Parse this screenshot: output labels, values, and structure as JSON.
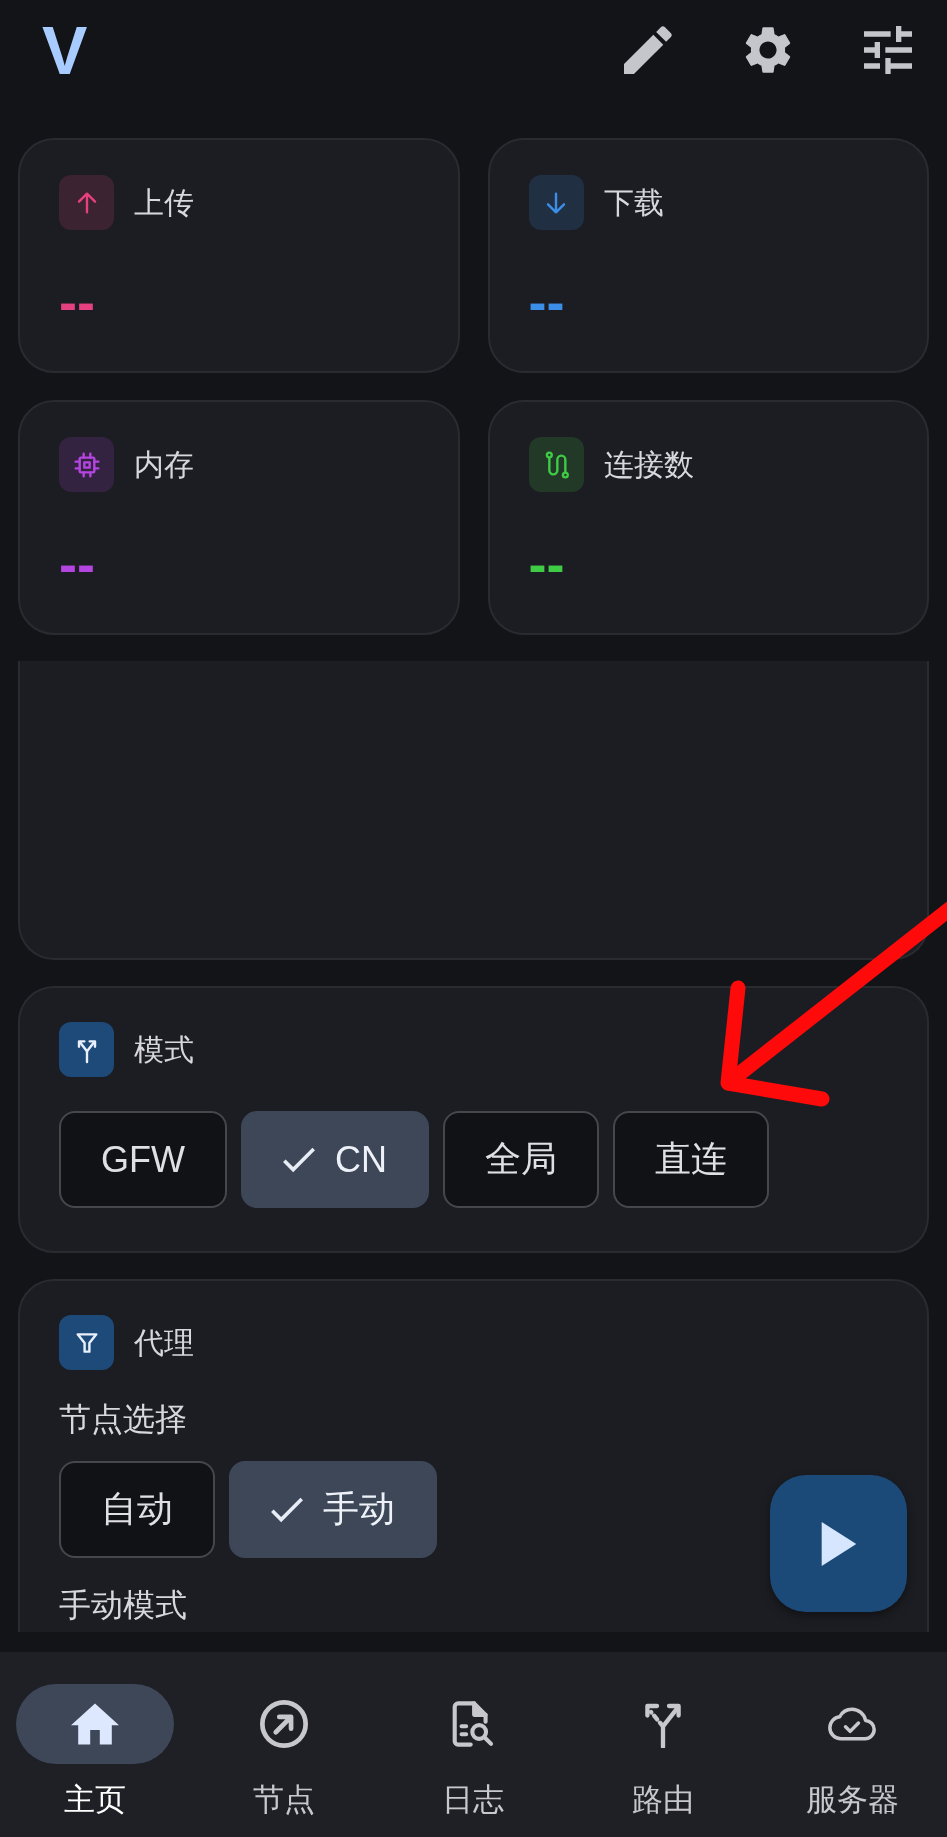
{
  "app_bar": {
    "logo": "V"
  },
  "stats": [
    {
      "kind": "upload",
      "label": "上传",
      "value": "--",
      "color": "#e5407f"
    },
    {
      "kind": "download",
      "label": "下载",
      "value": "--",
      "color": "#3b8fe8"
    },
    {
      "kind": "memory",
      "label": "内存",
      "value": "--",
      "color": "#b445e0"
    },
    {
      "kind": "connections",
      "label": "连接数",
      "value": "--",
      "color": "#3fcb45"
    }
  ],
  "mode_card": {
    "title": "模式",
    "options": [
      {
        "label": "GFW",
        "selected": false
      },
      {
        "label": "CN",
        "selected": true
      },
      {
        "label": "全局",
        "selected": false
      },
      {
        "label": "直连",
        "selected": false
      }
    ]
  },
  "proxy_card": {
    "title": "代理",
    "node_selection": {
      "label": "节点选择",
      "options": [
        {
          "label": "自动",
          "selected": false
        },
        {
          "label": "手动",
          "selected": true
        }
      ]
    },
    "manual_mode_label": "手动模式"
  },
  "bottom_nav": [
    {
      "kind": "home",
      "label": "主页",
      "selected": true
    },
    {
      "kind": "nodes",
      "label": "节点",
      "selected": false
    },
    {
      "kind": "logs",
      "label": "日志",
      "selected": false
    },
    {
      "kind": "routing",
      "label": "路由",
      "selected": false
    },
    {
      "kind": "servers",
      "label": "服务器",
      "selected": false
    }
  ],
  "annotations": [
    {
      "kind": "arrow"
    }
  ]
}
